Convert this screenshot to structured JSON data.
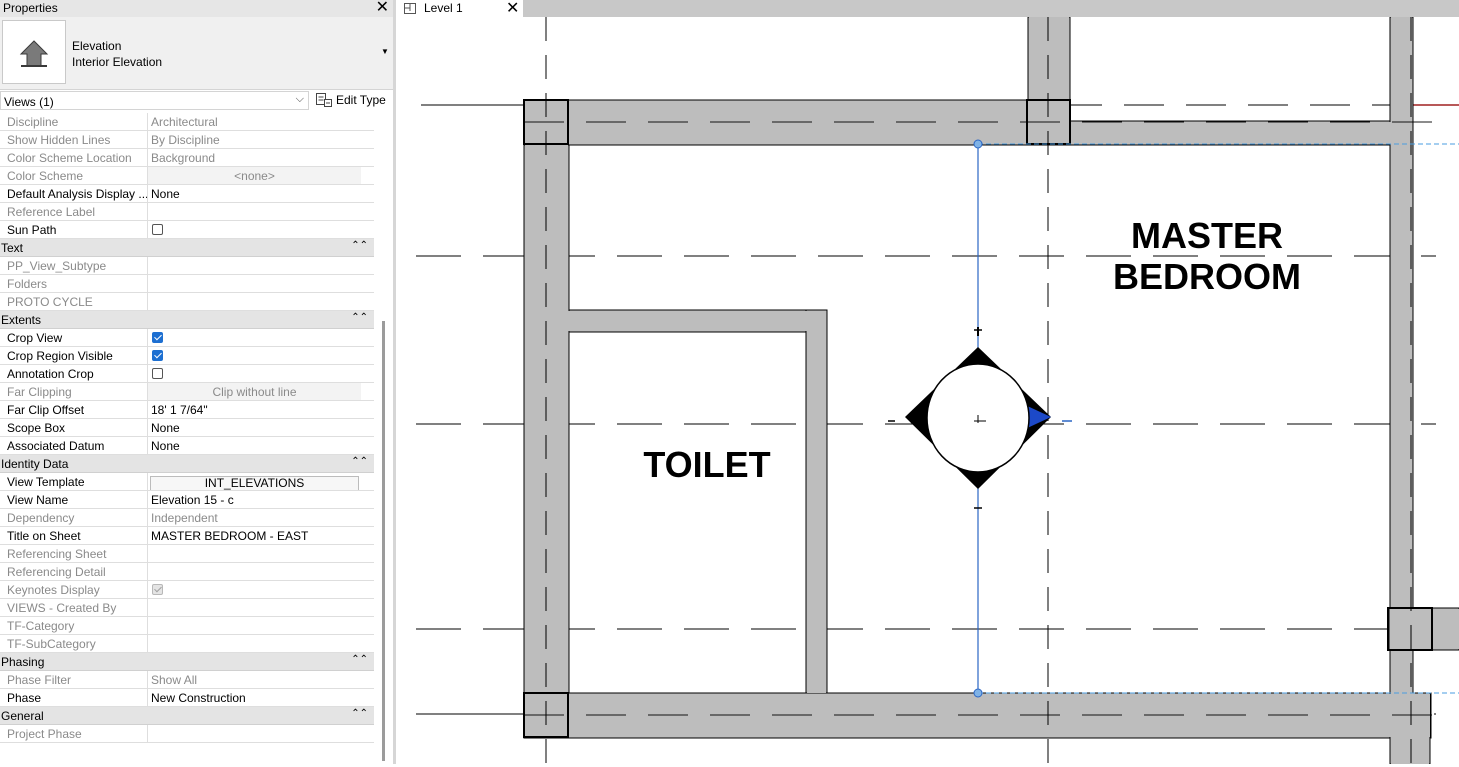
{
  "properties": {
    "title": "Properties",
    "close_icon": "close-icon",
    "type_icon": "elevation-arrow-icon",
    "family": "Elevation",
    "type": "Interior Elevation",
    "views_selector": "Views (1)",
    "edit_type": "Edit Type",
    "rows": [
      {
        "kind": "prop",
        "name": "Discipline",
        "value": "Architectural",
        "ro": true
      },
      {
        "kind": "prop",
        "name": "Show Hidden Lines",
        "value": "By Discipline",
        "ro": true
      },
      {
        "kind": "prop",
        "name": "Color Scheme Location",
        "value": "Background",
        "ro": true
      },
      {
        "kind": "prop",
        "name": "Color Scheme",
        "value": "<none>",
        "ro": true,
        "style": "center"
      },
      {
        "kind": "prop",
        "name": "Default Analysis Display ...",
        "value": "None",
        "ro": false
      },
      {
        "kind": "prop",
        "name": "Reference Label",
        "value": "",
        "ro": true
      },
      {
        "kind": "check",
        "name": "Sun Path",
        "checked": false,
        "ro": false
      },
      {
        "kind": "section",
        "name": "Text"
      },
      {
        "kind": "prop",
        "name": "PP_View_Subtype",
        "value": "",
        "ro": true
      },
      {
        "kind": "prop",
        "name": "Folders",
        "value": "",
        "ro": true
      },
      {
        "kind": "prop",
        "name": "PROTO CYCLE",
        "value": "",
        "ro": true
      },
      {
        "kind": "section",
        "name": "Extents"
      },
      {
        "kind": "check",
        "name": "Crop View",
        "checked": true,
        "ro": false
      },
      {
        "kind": "check",
        "name": "Crop Region Visible",
        "checked": true,
        "ro": false
      },
      {
        "kind": "check",
        "name": "Annotation Crop",
        "checked": false,
        "ro": false
      },
      {
        "kind": "prop",
        "name": "Far Clipping",
        "value": "Clip without line",
        "ro": true,
        "style": "center"
      },
      {
        "kind": "prop",
        "name": "Far Clip Offset",
        "value": "18'  1 7/64\"",
        "ro": false
      },
      {
        "kind": "prop",
        "name": "Scope Box",
        "value": "None",
        "ro": false
      },
      {
        "kind": "prop",
        "name": "Associated Datum",
        "value": "None",
        "ro": false
      },
      {
        "kind": "section",
        "name": "Identity Data"
      },
      {
        "kind": "prop",
        "name": "View Template",
        "value": "INT_ELEVATIONS",
        "ro": false,
        "style": "btn"
      },
      {
        "kind": "prop",
        "name": "View Name",
        "value": "Elevation 15 - c",
        "ro": false
      },
      {
        "kind": "prop",
        "name": "Dependency",
        "value": "Independent",
        "ro": true
      },
      {
        "kind": "prop",
        "name": "Title on Sheet",
        "value": "MASTER BEDROOM - EAST",
        "ro": false
      },
      {
        "kind": "prop",
        "name": "Referencing Sheet",
        "value": "",
        "ro": true
      },
      {
        "kind": "prop",
        "name": "Referencing Detail",
        "value": "",
        "ro": true
      },
      {
        "kind": "check",
        "name": "Keynotes Display",
        "checked": true,
        "ro": true
      },
      {
        "kind": "prop",
        "name": "VIEWS - Created By",
        "value": "",
        "ro": true
      },
      {
        "kind": "prop",
        "name": "TF-Category",
        "value": "",
        "ro": true
      },
      {
        "kind": "prop",
        "name": "TF-SubCategory",
        "value": "",
        "ro": true
      },
      {
        "kind": "section",
        "name": "Phasing"
      },
      {
        "kind": "prop",
        "name": "Phase Filter",
        "value": "Show All",
        "ro": true
      },
      {
        "kind": "prop",
        "name": "Phase",
        "value": "New Construction",
        "ro": false
      },
      {
        "kind": "section",
        "name": "General"
      },
      {
        "kind": "prop",
        "name": "Project Phase",
        "value": "",
        "ro": true
      }
    ]
  },
  "view_tab": {
    "label": "Level 1",
    "icon": "floor-plan-view-icon",
    "close_icon": "close-icon"
  },
  "canvas": {
    "room_labels": [
      {
        "line1": "MASTER",
        "line2": "BEDROOM"
      },
      {
        "line1": "TOILET",
        "line2": ""
      }
    ],
    "wall_color": "#bdbdbd",
    "selection_color": "#2b66c4",
    "elevation_marker": "interior-elevation-marker"
  }
}
